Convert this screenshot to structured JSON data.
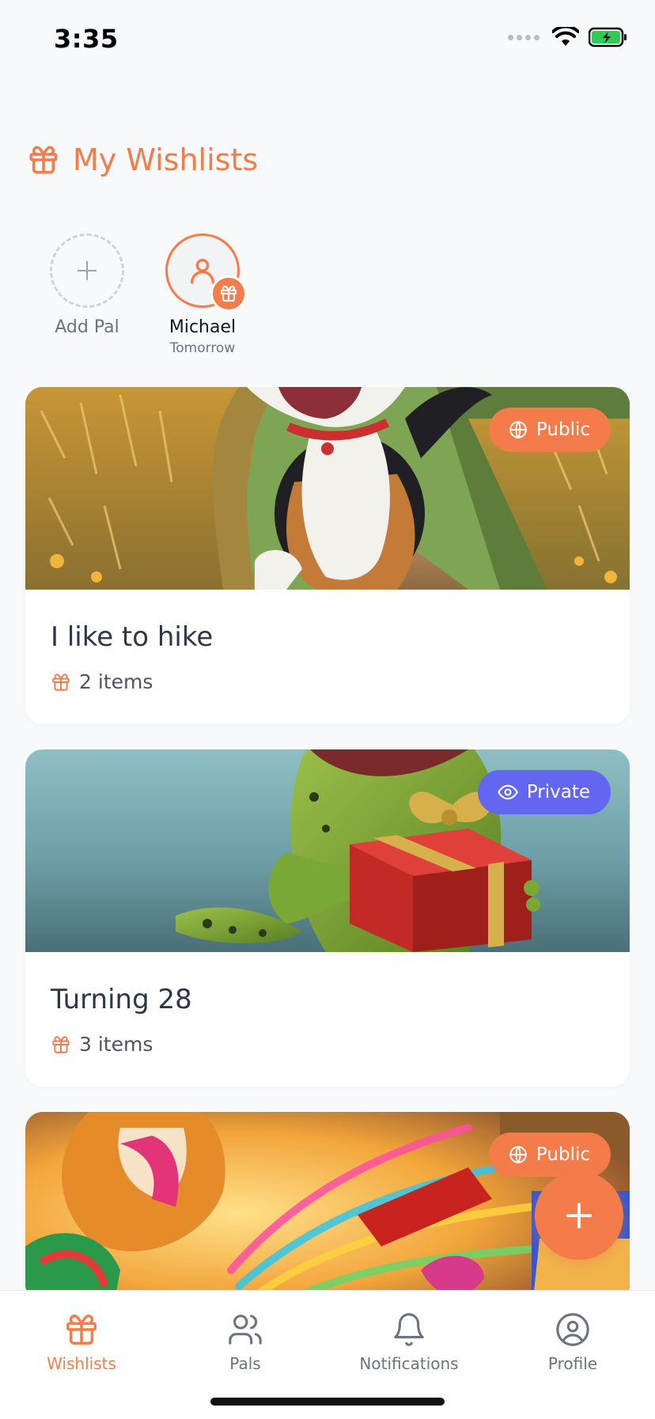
{
  "status_bar": {
    "time": "3:35"
  },
  "header": {
    "title": "My Wishlists",
    "icon": "gift-icon"
  },
  "pals": [
    {
      "name": "Add Pal",
      "sub": "",
      "icon": "plus-icon"
    },
    {
      "name": "Michael",
      "sub": "Tomorrow",
      "icon": "user-icon",
      "badge_icon": "gift-icon"
    }
  ],
  "wishlists": [
    {
      "title": "I like to hike",
      "items": "2 items",
      "visibility": "Public",
      "visibility_icon": "globe-icon",
      "image": "cartoon dog running through wheat field"
    },
    {
      "title": "Turning 28",
      "items": "3 items",
      "visibility": "Private",
      "visibility_icon": "eye-icon",
      "image": "cartoon frog holding red gift box"
    },
    {
      "title": "",
      "items": "",
      "visibility": "Public",
      "visibility_icon": "globe-icon",
      "image": "colorful cartoon lion with fireworks"
    }
  ],
  "tabs": [
    {
      "label": "Wishlists",
      "icon": "gift-icon",
      "active": true
    },
    {
      "label": "Pals",
      "icon": "users-icon",
      "active": false
    },
    {
      "label": "Notifications",
      "icon": "bell-icon",
      "active": false
    },
    {
      "label": "Profile",
      "icon": "user-circle-icon",
      "active": false
    }
  ],
  "colors": {
    "accent": "#f47c4a",
    "private": "#6366f1",
    "text": "#2d3748",
    "muted": "#6b7280"
  }
}
